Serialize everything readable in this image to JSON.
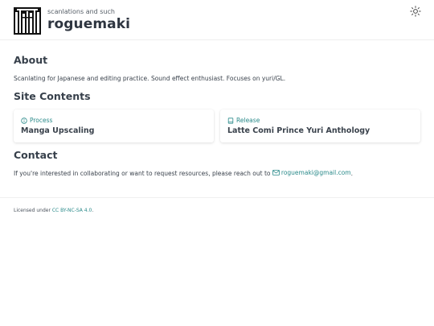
{
  "header": {
    "tagline": "scanlations and such",
    "title": "roguemaki",
    "theme_icon": "sun-icon"
  },
  "about": {
    "heading": "About",
    "text": "Scanlating for Japanese and editing practice. Sound effect enthusiast. Focuses on yuri/GL."
  },
  "contents": {
    "heading": "Site Contents",
    "cards": [
      {
        "category": "Process",
        "icon": "info-circle-icon",
        "title": "Manga Upscaling"
      },
      {
        "category": "Release",
        "icon": "book-icon",
        "title": "Latte Comi Prince Yuri Anthology"
      }
    ]
  },
  "contact": {
    "heading": "Contact",
    "text": "If you're interested in collaborating or want to request resources, please reach out to",
    "email": "roguemaki@gmail.com",
    "email_icon": "mail-icon",
    "trailing": "."
  },
  "footer": {
    "prefix": "Licensed under",
    "license": "CC BY-NC-SA 4.0",
    "suffix": "."
  },
  "colors": {
    "accent": "#2a8a8a",
    "text": "#333b45",
    "heading": "#37404b"
  }
}
